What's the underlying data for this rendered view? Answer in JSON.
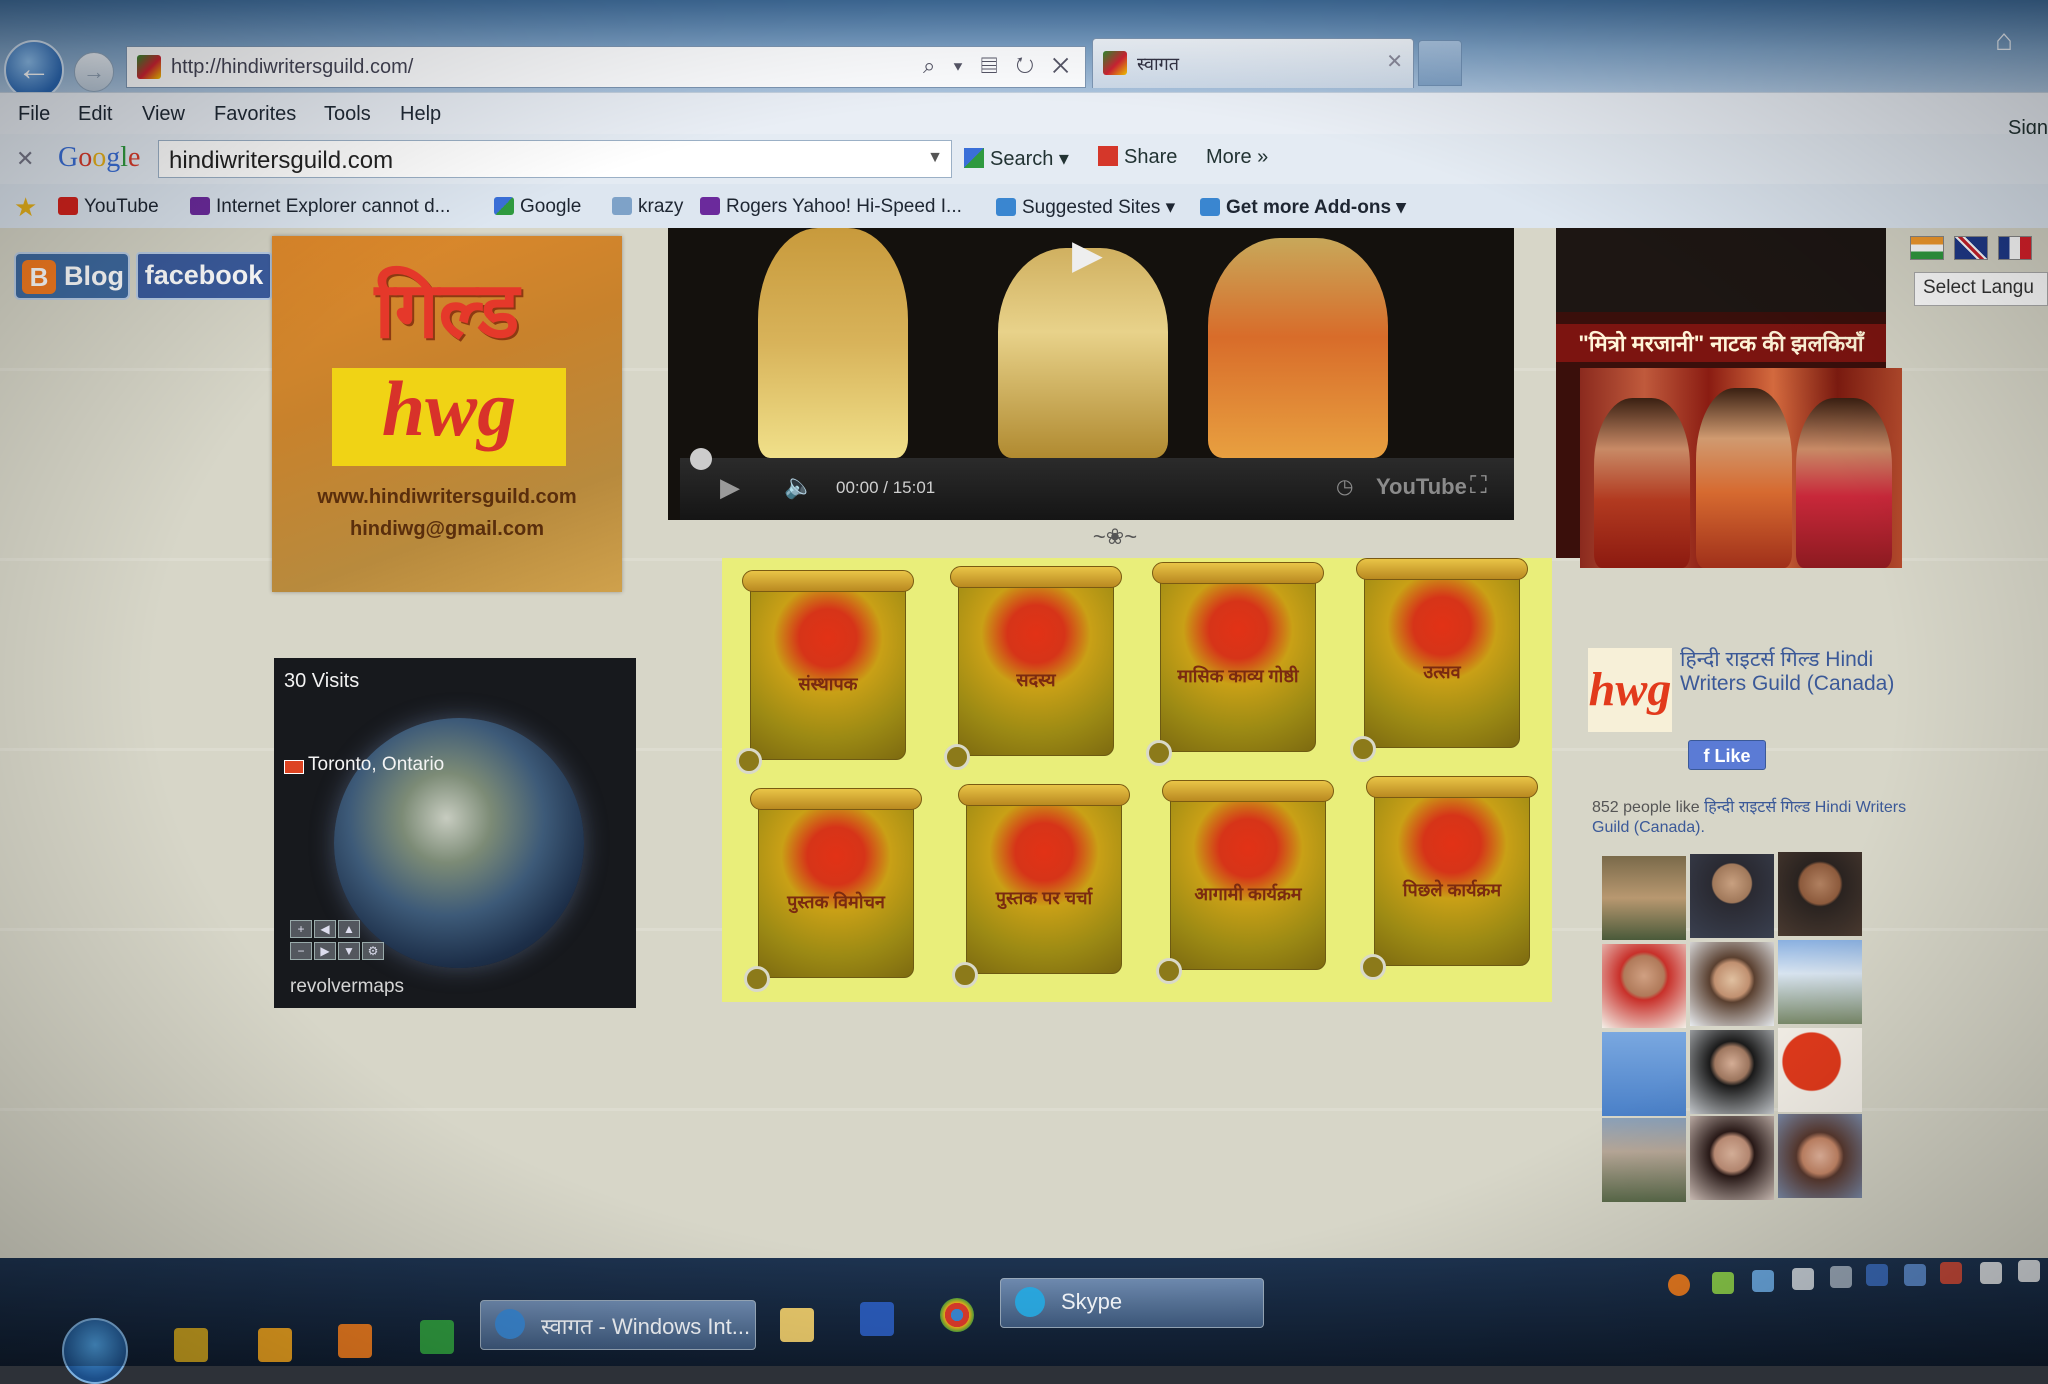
{
  "browser": {
    "url": "http://hindiwritersguild.com/",
    "tab_title": "स्वागत",
    "address_tools": "⌕ ▾ ▤ ↻ ✕"
  },
  "menu": [
    "File",
    "Edit",
    "View",
    "Favorites",
    "Tools",
    "Help"
  ],
  "google_toolbar": {
    "logo": "Google",
    "search_value": "hindiwritersguild.com",
    "search_button": "Search",
    "share_button": "Share",
    "more_button": "More »",
    "sign_in": "Sign"
  },
  "favorites": [
    "YouTube",
    "Internet Explorer cannot d...",
    "Google",
    "krazy",
    "Rogers Yahoo! Hi-Speed I...",
    "Suggested Sites ▾",
    "Get more Add-ons ▾"
  ],
  "page": {
    "blog_button": "Blog",
    "blog_icon": "B",
    "facebook_button": "facebook",
    "logo": {
      "hindi": "गिल्ड",
      "abbr": "hwg",
      "website": "www.hindiwritersguild.com",
      "email": "hindiwg@gmail.com"
    },
    "video": {
      "time": "00:00 / 15:01",
      "play_icon": "▶",
      "volume_icon": "🔈",
      "youtube_logo": "YouTube",
      "fullscreen_icon": "⛶",
      "clock_icon": "◷"
    },
    "ornament": "~❀~",
    "scrolls": [
      "संस्थापक",
      "सदस्य",
      "मासिक काव्य गोष्ठी",
      "उत्सव",
      "पुस्तक विमोचन",
      "पुस्तक पर चर्चा",
      "आगामी कार्यक्रम",
      "पिछले कार्यक्रम"
    ],
    "map_widget": {
      "visits": "30 Visits",
      "location": "Toronto, Ontario",
      "brand": "revolvermaps"
    },
    "promo_caption": "\"मित्रो मरजानी\" नाटक की झलकियाँ",
    "language": {
      "select_label": "Select Langu"
    },
    "facebook_box": {
      "page_name": "हिन्दी राइटर्स गिल्ड Hindi Writers Guild (Canada)",
      "like_button": "Like",
      "logo_text": "hwg",
      "count_text": "852 people like",
      "count_page": "हिन्दी राइटर्स गिल्ड Hindi Writers Guild (Canada)."
    }
  },
  "taskbar": {
    "tasks": [
      "स्वागत - Windows Int...",
      "Skype"
    ]
  },
  "colors": {
    "page_bg": "#d7d6c8",
    "scroll_grid_bg": "#e9ee7a",
    "facebook_blue": "#3b5998",
    "blogger_orange": "#f47b20"
  }
}
